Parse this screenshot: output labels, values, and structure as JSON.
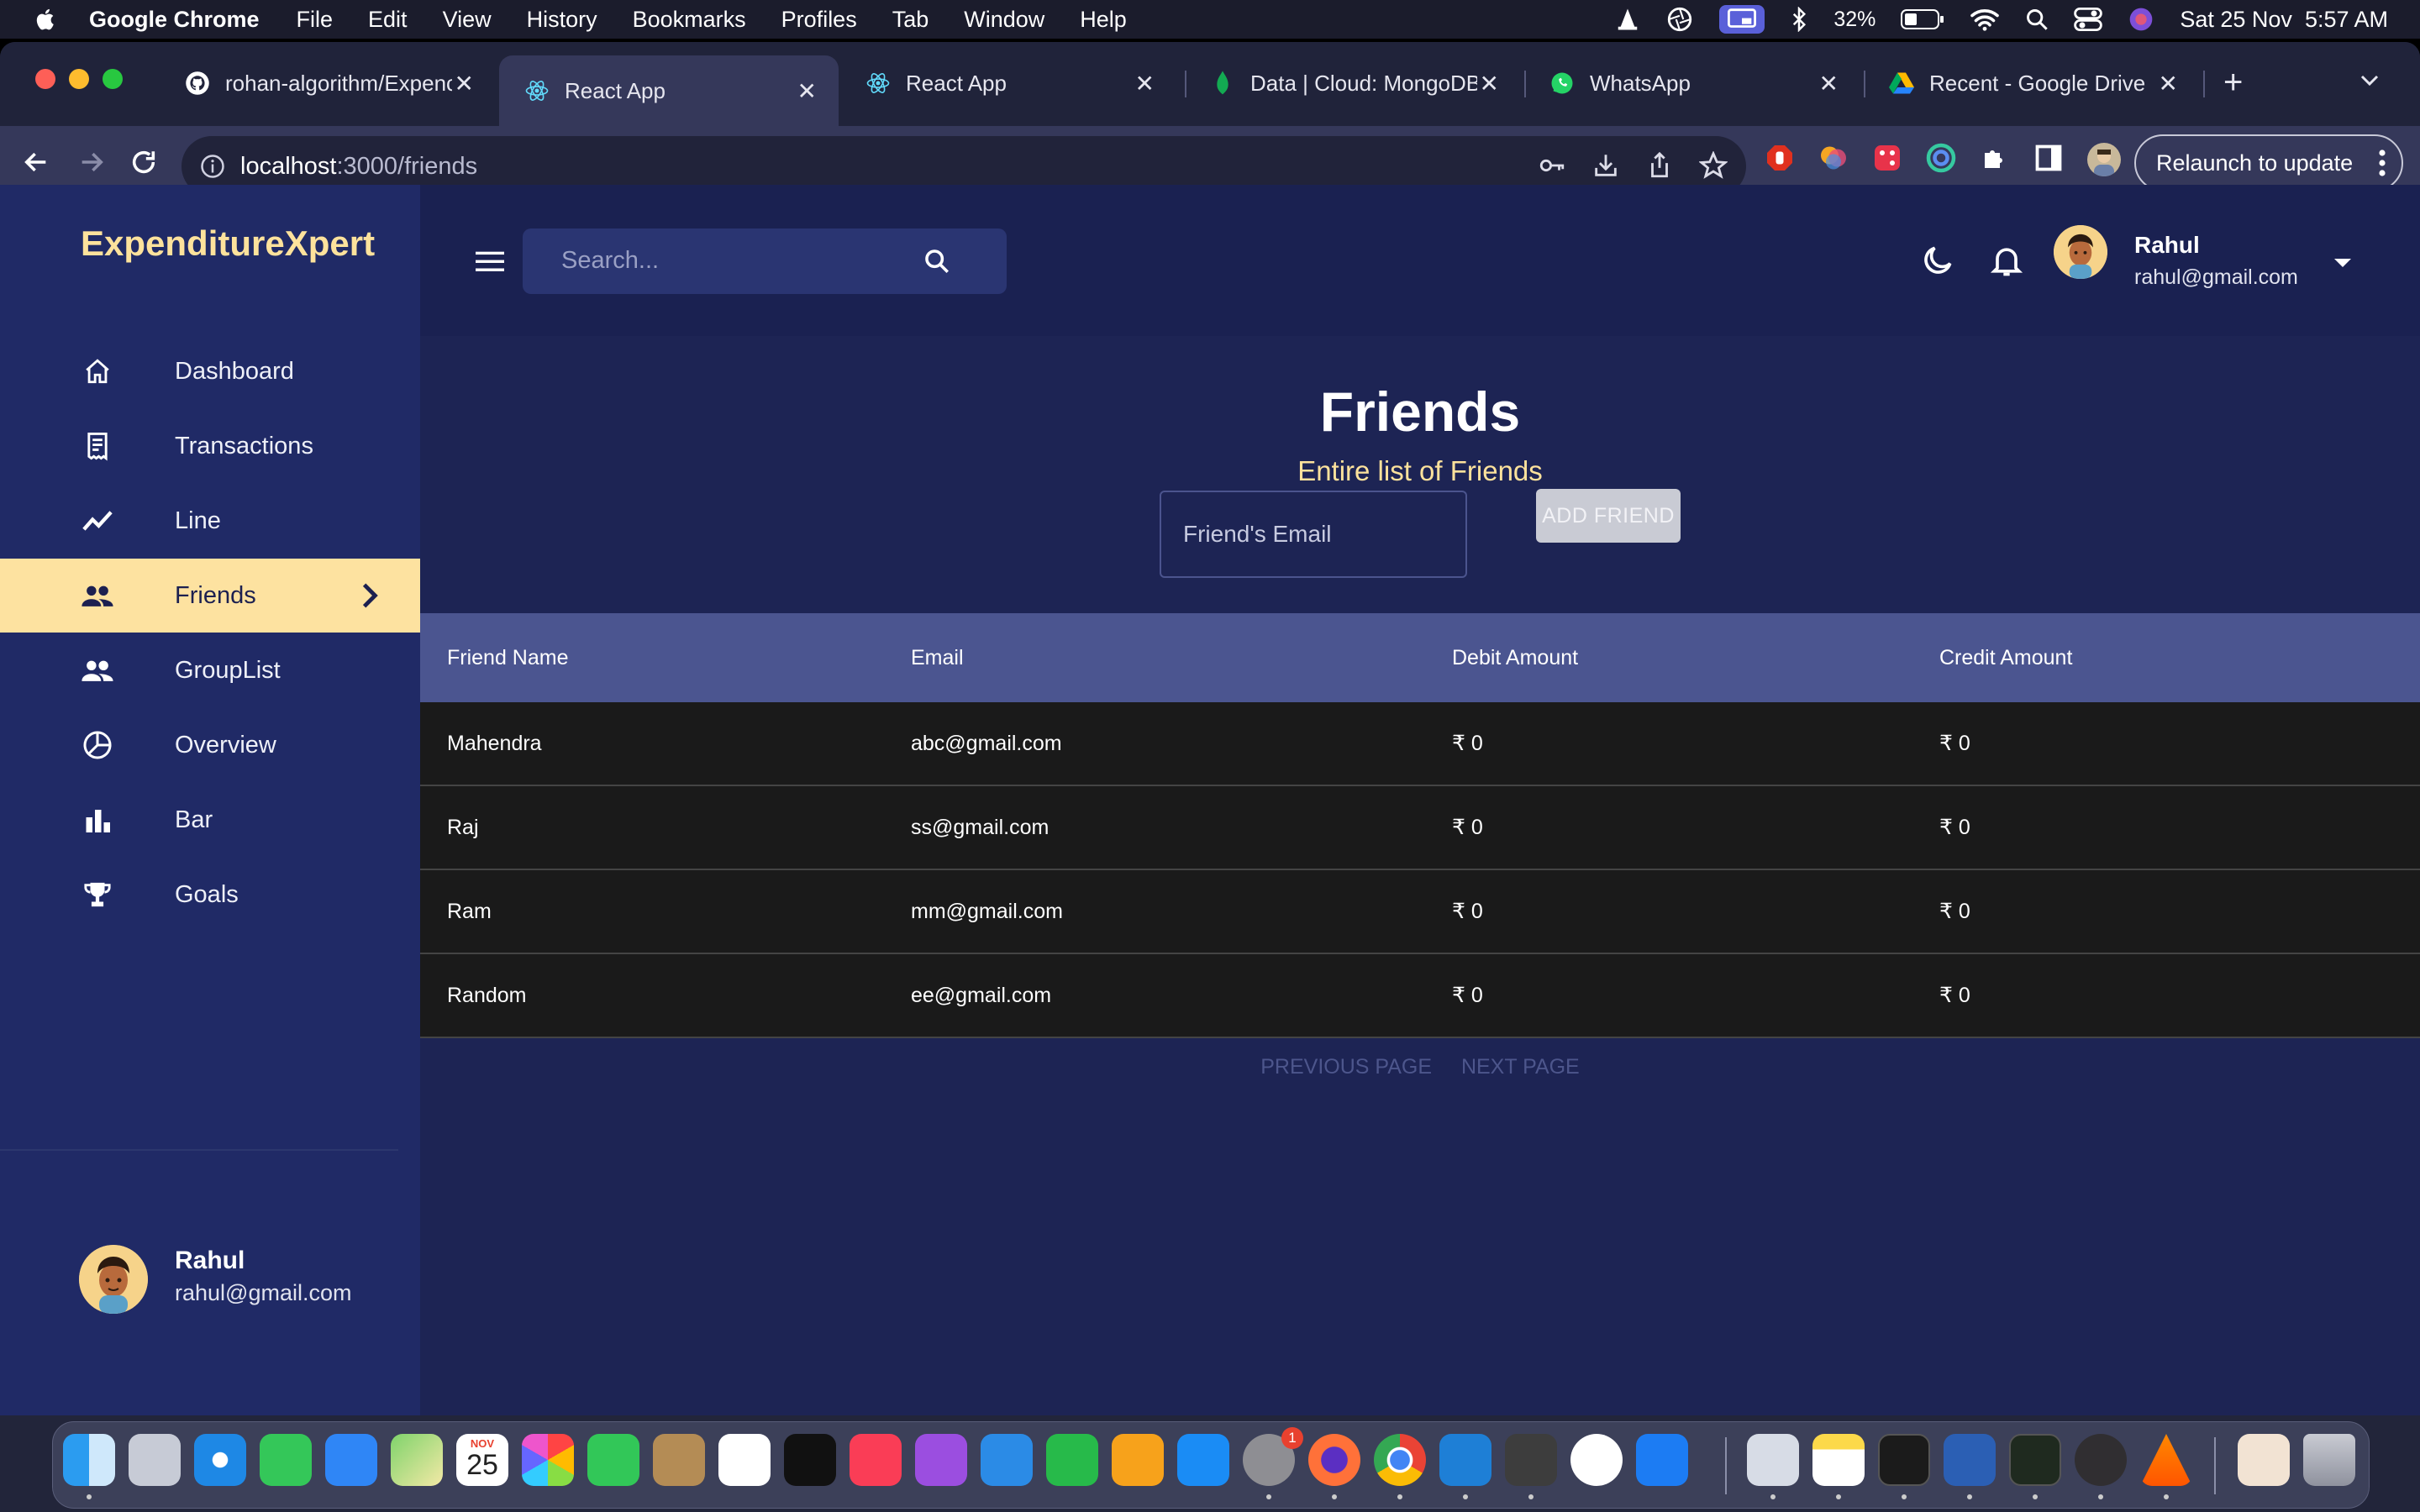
{
  "menubar": {
    "app_name": "Google Chrome",
    "items": [
      "File",
      "Edit",
      "View",
      "History",
      "Bookmarks",
      "Profiles",
      "Tab",
      "Window",
      "Help"
    ],
    "battery": "32%",
    "datetime": "Sat 25 Nov  5:57 AM"
  },
  "browser": {
    "tabs": [
      {
        "title": "rohan-algorithm/Expenc",
        "icon": "github-icon"
      },
      {
        "title": "React App",
        "icon": "react-icon",
        "active": true
      },
      {
        "title": "React App",
        "icon": "react-icon"
      },
      {
        "title": "Data | Cloud: MongoDB",
        "icon": "mongodb-icon"
      },
      {
        "title": "WhatsApp",
        "icon": "whatsapp-icon"
      },
      {
        "title": "Recent - Google Drive",
        "icon": "google-drive-icon"
      }
    ],
    "url_host": "localhost",
    "url_path": ":3000/friends",
    "relaunch_label": "Relaunch to update"
  },
  "sidebar": {
    "brand": "ExpenditureXpert",
    "items": [
      {
        "label": "Dashboard",
        "icon": "home-icon"
      },
      {
        "label": "Transactions",
        "icon": "receipt-icon"
      },
      {
        "label": "Line",
        "icon": "line-chart-icon"
      },
      {
        "label": "Friends",
        "icon": "people-icon",
        "active": true
      },
      {
        "label": "GroupList",
        "icon": "group-icon"
      },
      {
        "label": "Overview",
        "icon": "pie-chart-icon"
      },
      {
        "label": "Bar",
        "icon": "bar-chart-icon"
      },
      {
        "label": "Goals",
        "icon": "trophy-icon"
      }
    ],
    "user": {
      "name": "Rahul",
      "email": "rahul@gmail.com"
    }
  },
  "topbar": {
    "search_placeholder": "Search...",
    "user": {
      "name": "Rahul",
      "email": "rahul@gmail.com"
    }
  },
  "page": {
    "title": "Friends",
    "subtitle": "Entire list of Friends",
    "email_placeholder": "Friend's Email",
    "add_button": "ADD FRIEND"
  },
  "table": {
    "headers": [
      "Friend Name",
      "Email",
      "Debit Amount",
      "Credit Amount"
    ],
    "rows": [
      [
        "Mahendra",
        "abc@gmail.com",
        "₹ 0",
        "₹ 0"
      ],
      [
        "Raj",
        "ss@gmail.com",
        "₹ 0",
        "₹ 0"
      ],
      [
        "Ram",
        "mm@gmail.com",
        "₹ 0",
        "₹ 0"
      ],
      [
        "Random",
        "ee@gmail.com",
        "₹ 0",
        "₹ 0"
      ]
    ]
  },
  "pager": {
    "prev": "PREVIOUS PAGE",
    "next": "NEXT PAGE"
  },
  "dock": {
    "apps": [
      "Finder",
      "Launchpad",
      "Safari",
      "Messages",
      "Mail",
      "Maps",
      "Calendar",
      "Photos",
      "FaceTime",
      "Contacts",
      "Reminders",
      "Apple TV",
      "Music",
      "Podcasts",
      "Keynote",
      "Numbers",
      "Pages",
      "App Store",
      "System Settings",
      "Firefox",
      "Chrome",
      "VS Code",
      "Sublime Text",
      "AI",
      "Xcode",
      "Preview",
      "Notes",
      "Terminal",
      "Word",
      "Activity Monitor",
      "OBS",
      "VLC",
      "Users",
      "Trash"
    ],
    "calendar_month": "NOV",
    "calendar_day": "25",
    "settings_badge": "1"
  },
  "colors": {
    "sidebar_bg": "#202a66",
    "content_bg": "#1d2454",
    "accent": "#fde29c",
    "table_header": "#4b5590",
    "row_bg": "#1a1a1a"
  }
}
